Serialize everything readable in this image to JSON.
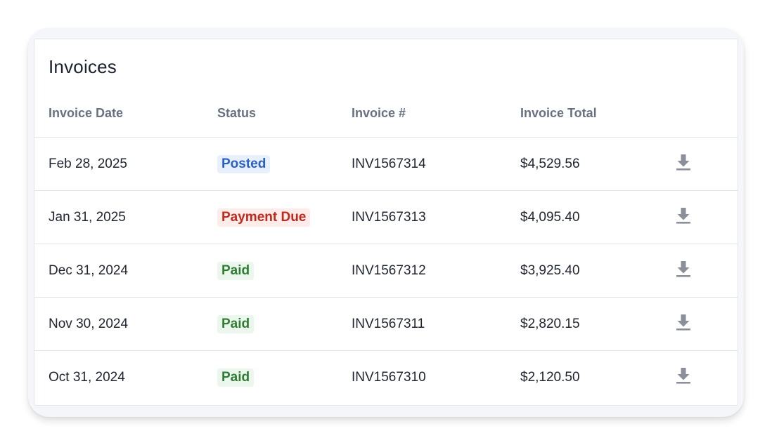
{
  "card": {
    "title": "Invoices"
  },
  "table": {
    "headers": {
      "date": "Invoice Date",
      "status": "Status",
      "number": "Invoice #",
      "total": "Invoice Total"
    },
    "rows": [
      {
        "date": "Feb 28, 2025",
        "status": "Posted",
        "status_kind": "posted",
        "number": "INV1567314",
        "total": "$4,529.56"
      },
      {
        "date": "Jan 31, 2025",
        "status": "Payment Due",
        "status_kind": "due",
        "number": "INV1567313",
        "total": "$4,095.40"
      },
      {
        "date": "Dec 31, 2024",
        "status": "Paid",
        "status_kind": "paid",
        "number": "INV1567312",
        "total": "$3,925.40"
      },
      {
        "date": "Nov 30, 2024",
        "status": "Paid",
        "status_kind": "paid",
        "number": "INV1567311",
        "total": "$2,820.15"
      },
      {
        "date": "Oct 31, 2024",
        "status": "Paid",
        "status_kind": "paid",
        "number": "INV1567310",
        "total": "$2,120.50"
      }
    ],
    "row_action_icon": "download-icon"
  },
  "colors": {
    "posted_bg": "#e9f0fd",
    "posted_text": "#2a5fc4",
    "due_bg": "#fdecea",
    "due_text": "#bf2a1f",
    "paid_bg": "#ebf6ec",
    "paid_text": "#2e7d32",
    "icon": "#8a8f99"
  }
}
